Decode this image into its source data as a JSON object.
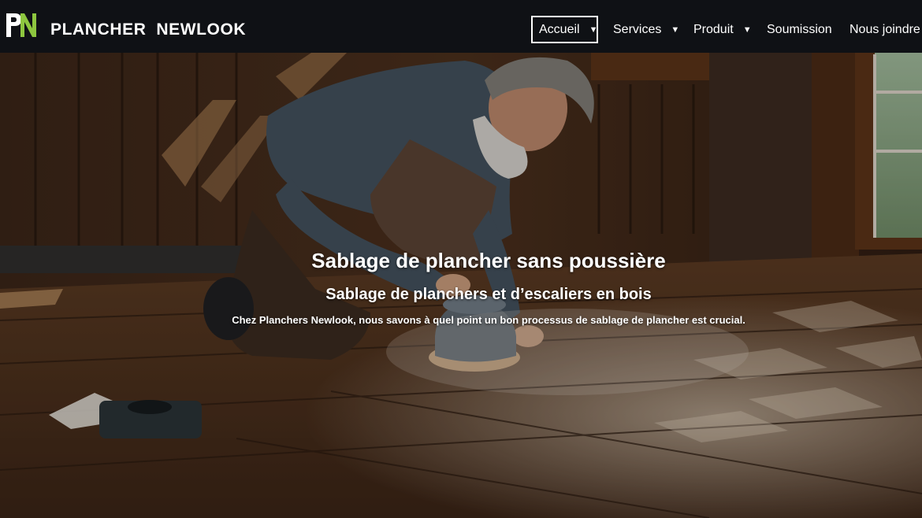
{
  "brand": {
    "logo_text": "PN",
    "name": "PLANCHER  NEWLOOK",
    "colors": {
      "p": "#ffffff",
      "n": "#8dc63f"
    }
  },
  "nav": {
    "items": [
      {
        "label": "Accueil",
        "has_dropdown": true,
        "active": true
      },
      {
        "label": "Services",
        "has_dropdown": true,
        "active": false
      },
      {
        "label": "Produit",
        "has_dropdown": true,
        "active": false
      },
      {
        "label": "Soumission",
        "has_dropdown": false,
        "active": false
      },
      {
        "label": "Nous joindre",
        "has_dropdown": false,
        "active": false
      }
    ],
    "caret": "▼"
  },
  "hero": {
    "title": "Sablage de plancher sans poussière",
    "subtitle": "Sablage de planchers et d’escaliers en bois",
    "description": "Chez Planchers Newlook, nous savons à quel point un bon processus de sablage de plancher est crucial."
  },
  "colors": {
    "header_bg": "#0f1115",
    "accent_green": "#8dc63f",
    "text": "#ffffff"
  }
}
